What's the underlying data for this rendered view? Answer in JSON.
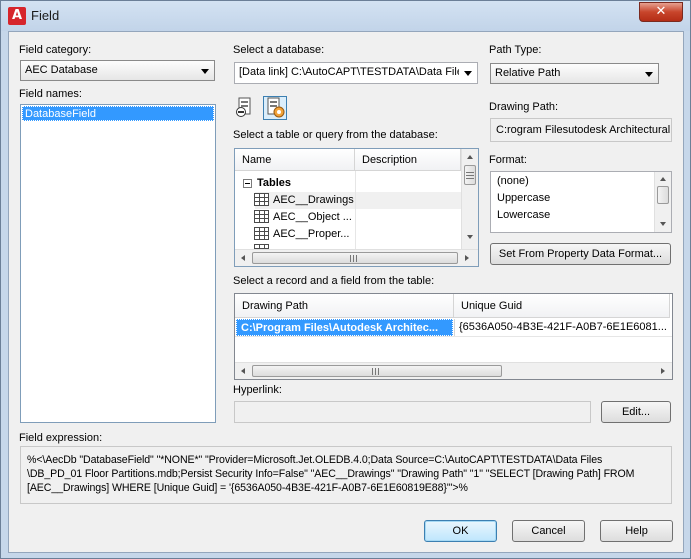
{
  "window": {
    "title": "Field",
    "close_glyph": "✕",
    "app_icon_letter": "A"
  },
  "left": {
    "category_label": "Field category:",
    "category_value": "AEC Database",
    "names_label": "Field names:",
    "names": [
      "DatabaseField"
    ]
  },
  "database": {
    "label": "Select a database:",
    "value": "[Data link] C:\\AutoCAPT\\TESTDATA\\Data Files"
  },
  "table_query": {
    "label": "Select a table or query from the database:",
    "columns": [
      "Name",
      "Description"
    ],
    "group": "Tables",
    "group_toggle": "⊟",
    "rows": [
      "AEC__Drawings",
      "AEC__Object ...",
      "AEC__Proper..."
    ]
  },
  "path_type": {
    "label": "Path Type:",
    "value": "Relative Path"
  },
  "drawing_path": {
    "label": "Drawing Path:",
    "value": "C:rogram Filesutodesk Architectural"
  },
  "format": {
    "label": "Format:",
    "options": [
      "(none)",
      "Uppercase",
      "Lowercase"
    ],
    "set_button": "Set From Property Data Format..."
  },
  "record": {
    "label": "Select a record and a field from the table:",
    "columns": [
      "Drawing Path",
      "Unique Guid"
    ],
    "row": {
      "drawing_path": "C:\\Program Files\\Autodesk Architec...",
      "unique_guid": "{6536A050-4B3E-421F-A0B7-6E1E6081..."
    }
  },
  "hyperlink": {
    "label": "Hyperlink:",
    "value": "",
    "edit_button": "Edit..."
  },
  "expression": {
    "label": "Field expression:",
    "lines": [
      "%<\\AecDb \"DatabaseField\" \"*NONE*\" \"Provider=Microsoft.Jet.OLEDB.4.0;Data Source=C:\\AutoCAPT\\TESTDATA\\Data Files",
      "\\DB_PD_01 Floor Partitions.mdb;Persist Security Info=False\" \"AEC__Drawings\" \"Drawing Path\" \"1\" \"SELECT [Drawing Path] FROM",
      "[AEC__Drawings] WHERE [Unique Guid] = '{6536A050-4B3E-421F-A0B7-6E1E60819E88}'\">%"
    ]
  },
  "buttons": {
    "ok": "OK",
    "cancel": "Cancel",
    "help": "Help"
  },
  "colors": {
    "accent": "#3399ff",
    "title_bar": "#c6d7ea",
    "close_button": "#c8452b"
  },
  "icons": [
    "database-link-icon",
    "data-link-config-icon",
    "table-icon"
  ]
}
